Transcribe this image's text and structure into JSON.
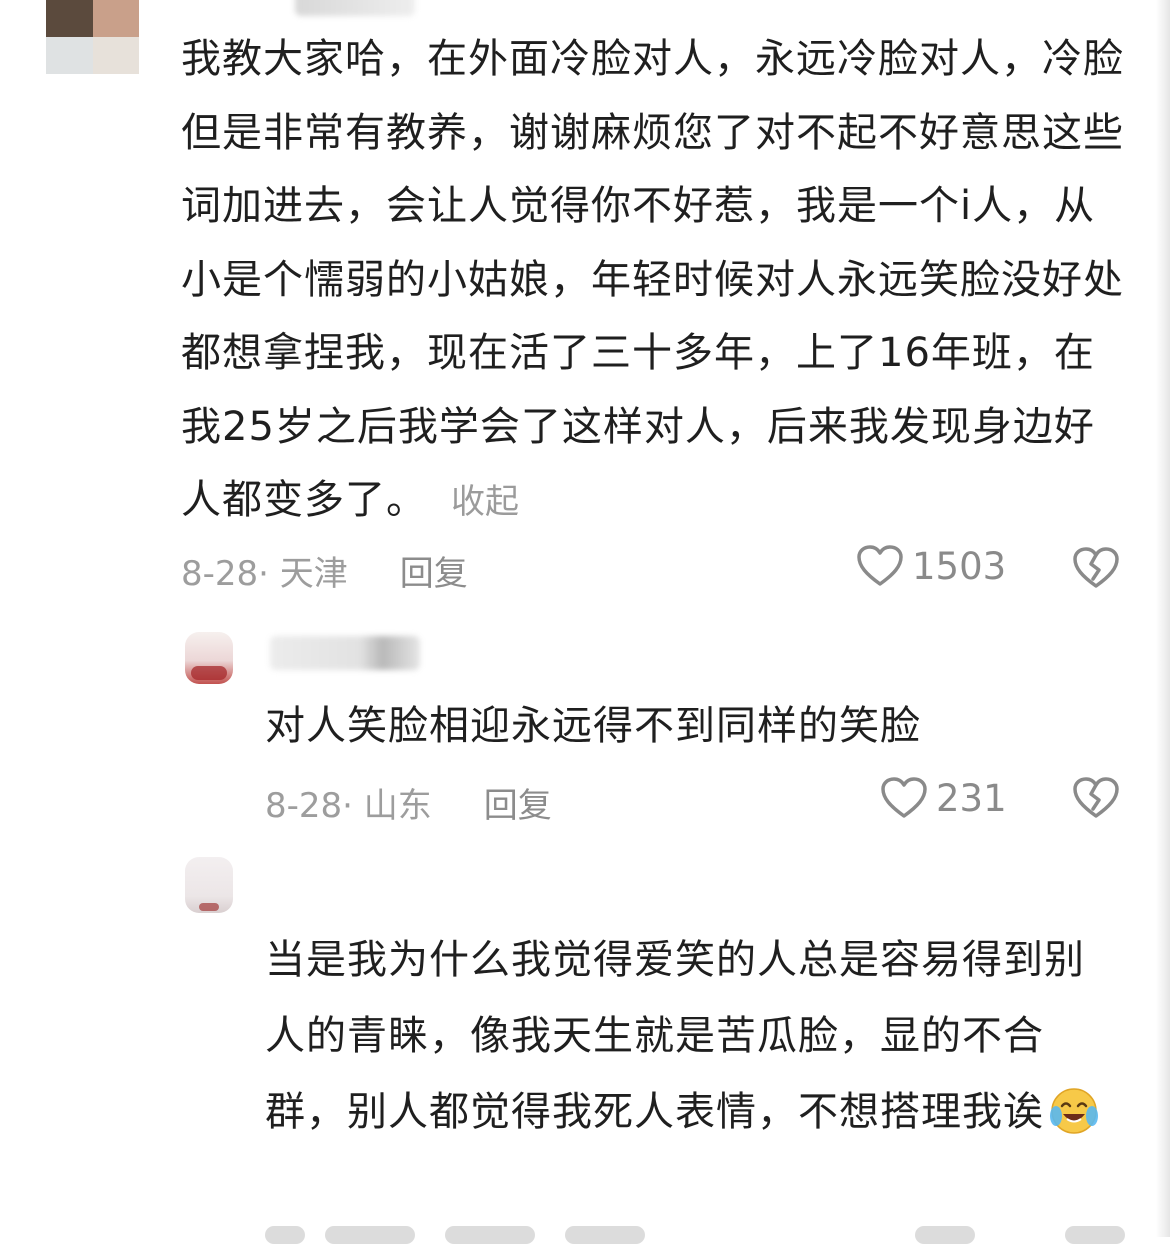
{
  "comments": {
    "main": {
      "text": "我教大家哈，在外面冷脸对人，永远冷脸对人，冷脸但是非常有教养，谢谢麻烦您了对不起不好意思这些词加进去，会让人觉得你不好惹，我是一个i人，从小是个懦弱的小姑娘，年轻时候对人永远笑脸没好处都想拿捏我，现在活了三十多年，上了16年班，在我25岁之后我学会了这样对人，后来我发现身边好人都变多了。",
      "collapse_label": "收起",
      "meta": "8-28· 天津",
      "reply_label": "回复",
      "likes": "1503"
    },
    "reply1": {
      "text": "对人笑脸相迎永远得不到同样的笑脸",
      "meta": "8-28· 山东",
      "reply_label": "回复",
      "likes": "231"
    },
    "reply2": {
      "text": "当是我为什么我觉得爱笑的人总是容易得到别人的青睐，像我天生就是苦瓜脸，显的不合群，别人都觉得我死人表情，不想搭理我诶"
    }
  },
  "icons": {
    "like": "heart-outline-icon",
    "dislike": "broken-heart-icon",
    "emoji": "crying-laughing-emoji"
  },
  "colors": {
    "text": "#1f1f1f",
    "meta": "#9d9d9d",
    "icon": "#8a8a8a"
  }
}
